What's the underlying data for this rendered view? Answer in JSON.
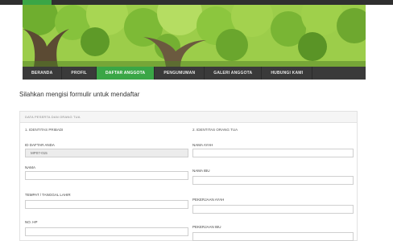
{
  "topbar": {
    "tab_label": ""
  },
  "nav": {
    "items": [
      {
        "label": "BERANDA",
        "active": false
      },
      {
        "label": "PROFIL",
        "active": false
      },
      {
        "label": "DAFTAR ANGGOTA",
        "active": true
      },
      {
        "label": "PENGUMUMAN",
        "active": false
      },
      {
        "label": "GALERI ANGGOTA",
        "active": false
      },
      {
        "label": "HUBUNGI KAMI",
        "active": false
      }
    ]
  },
  "page": {
    "heading": "Silahkan mengisi formulir untuk mendaftar"
  },
  "form": {
    "panel_title": "DATA PESERTA DAN ORANG TUA",
    "left": {
      "section_title": "1. IDENTITAS PRIBADI",
      "id_label": "ID DAFTAR ANDA",
      "id_value": "MP07-015",
      "nama_label": "NAMA",
      "ttl_label": "TEMPAT / TANGGAL LAHIR",
      "hp_label": "NO. HP"
    },
    "right": {
      "section_title": "2. IDENTITAS ORANG TUA",
      "ayah_label": "NAMA AYAH",
      "ibu_label": "NAMA IBU",
      "pekerjaan_ayah_label": "PEKERJAAN AYAH",
      "pekerjaan_ibu_label": "PEKERJAAN IBU"
    }
  },
  "colors": {
    "nav_bg": "#3a3a3a",
    "nav_active": "#3aa646",
    "banner_foliage": "#8cc63e"
  }
}
